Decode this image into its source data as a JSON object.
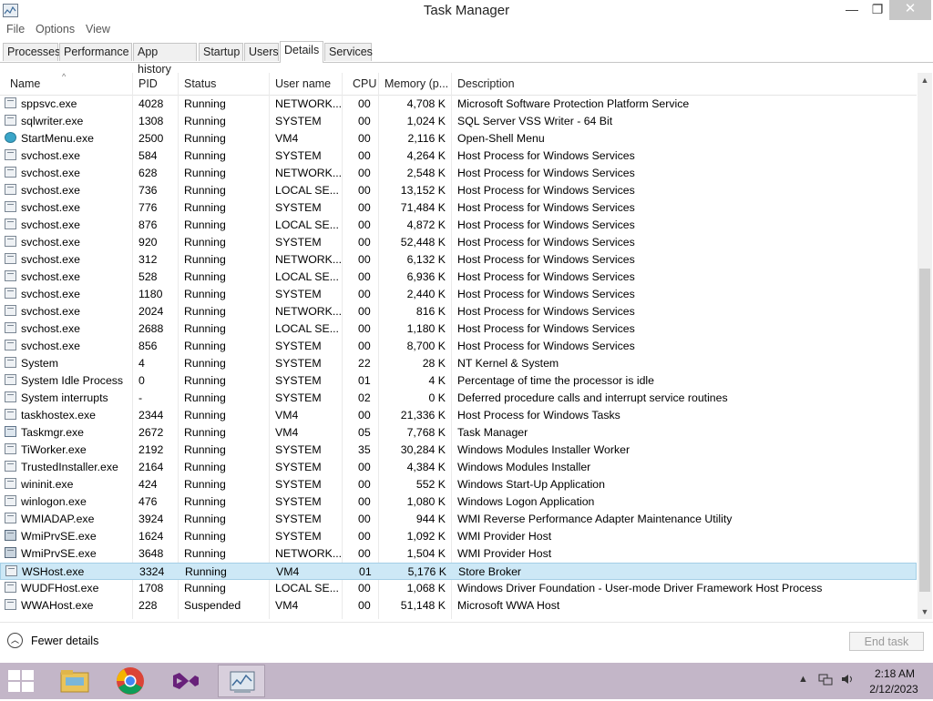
{
  "window": {
    "title": "Task Manager",
    "minimize_glyph": "—",
    "maximize_glyph": "❐",
    "close_glyph": "✕"
  },
  "menu": [
    "File",
    "Options",
    "View"
  ],
  "tabs": [
    {
      "label": "Processes",
      "active": false
    },
    {
      "label": "Performance",
      "active": false
    },
    {
      "label": "App history",
      "active": false
    },
    {
      "label": "Startup",
      "active": false
    },
    {
      "label": "Users",
      "active": false
    },
    {
      "label": "Details",
      "active": true
    },
    {
      "label": "Services",
      "active": false
    }
  ],
  "columns": [
    "Name",
    "PID",
    "Status",
    "User name",
    "CPU",
    "Memory (p...",
    "Description"
  ],
  "rows": [
    {
      "name": "sppsvc.exe",
      "pid": "4028",
      "status": "Running",
      "user": "NETWORK...",
      "cpu": "00",
      "mem": "4,708 K",
      "desc": "Microsoft Software Protection Platform Service",
      "icon": "app"
    },
    {
      "name": "sqlwriter.exe",
      "pid": "1308",
      "status": "Running",
      "user": "SYSTEM",
      "cpu": "00",
      "mem": "1,024 K",
      "desc": "SQL Server VSS Writer - 64 Bit",
      "icon": "app"
    },
    {
      "name": "StartMenu.exe",
      "pid": "2500",
      "status": "Running",
      "user": "VM4",
      "cpu": "00",
      "mem": "2,116 K",
      "desc": "Open-Shell Menu",
      "icon": "shell"
    },
    {
      "name": "svchost.exe",
      "pid": "584",
      "status": "Running",
      "user": "SYSTEM",
      "cpu": "00",
      "mem": "4,264 K",
      "desc": "Host Process for Windows Services",
      "icon": "app"
    },
    {
      "name": "svchost.exe",
      "pid": "628",
      "status": "Running",
      "user": "NETWORK...",
      "cpu": "00",
      "mem": "2,548 K",
      "desc": "Host Process for Windows Services",
      "icon": "app"
    },
    {
      "name": "svchost.exe",
      "pid": "736",
      "status": "Running",
      "user": "LOCAL SE...",
      "cpu": "00",
      "mem": "13,152 K",
      "desc": "Host Process for Windows Services",
      "icon": "app"
    },
    {
      "name": "svchost.exe",
      "pid": "776",
      "status": "Running",
      "user": "SYSTEM",
      "cpu": "00",
      "mem": "71,484 K",
      "desc": "Host Process for Windows Services",
      "icon": "app"
    },
    {
      "name": "svchost.exe",
      "pid": "876",
      "status": "Running",
      "user": "LOCAL SE...",
      "cpu": "00",
      "mem": "4,872 K",
      "desc": "Host Process for Windows Services",
      "icon": "app"
    },
    {
      "name": "svchost.exe",
      "pid": "920",
      "status": "Running",
      "user": "SYSTEM",
      "cpu": "00",
      "mem": "52,448 K",
      "desc": "Host Process for Windows Services",
      "icon": "app"
    },
    {
      "name": "svchost.exe",
      "pid": "312",
      "status": "Running",
      "user": "NETWORK...",
      "cpu": "00",
      "mem": "6,132 K",
      "desc": "Host Process for Windows Services",
      "icon": "app"
    },
    {
      "name": "svchost.exe",
      "pid": "528",
      "status": "Running",
      "user": "LOCAL SE...",
      "cpu": "00",
      "mem": "6,936 K",
      "desc": "Host Process for Windows Services",
      "icon": "app"
    },
    {
      "name": "svchost.exe",
      "pid": "1180",
      "status": "Running",
      "user": "SYSTEM",
      "cpu": "00",
      "mem": "2,440 K",
      "desc": "Host Process for Windows Services",
      "icon": "app"
    },
    {
      "name": "svchost.exe",
      "pid": "2024",
      "status": "Running",
      "user": "NETWORK...",
      "cpu": "00",
      "mem": "816 K",
      "desc": "Host Process for Windows Services",
      "icon": "app"
    },
    {
      "name": "svchost.exe",
      "pid": "2688",
      "status": "Running",
      "user": "LOCAL SE...",
      "cpu": "00",
      "mem": "1,180 K",
      "desc": "Host Process for Windows Services",
      "icon": "app"
    },
    {
      "name": "svchost.exe",
      "pid": "856",
      "status": "Running",
      "user": "SYSTEM",
      "cpu": "00",
      "mem": "8,700 K",
      "desc": "Host Process for Windows Services",
      "icon": "app"
    },
    {
      "name": "System",
      "pid": "4",
      "status": "Running",
      "user": "SYSTEM",
      "cpu": "22",
      "mem": "28 K",
      "desc": "NT Kernel & System",
      "icon": "app"
    },
    {
      "name": "System Idle Process",
      "pid": "0",
      "status": "Running",
      "user": "SYSTEM",
      "cpu": "01",
      "mem": "4 K",
      "desc": "Percentage of time the processor is idle",
      "icon": "app"
    },
    {
      "name": "System interrupts",
      "pid": "-",
      "status": "Running",
      "user": "SYSTEM",
      "cpu": "02",
      "mem": "0 K",
      "desc": "Deferred procedure calls and interrupt service routines",
      "icon": "app"
    },
    {
      "name": "taskhostex.exe",
      "pid": "2344",
      "status": "Running",
      "user": "VM4",
      "cpu": "00",
      "mem": "21,336 K",
      "desc": "Host Process for Windows Tasks",
      "icon": "app"
    },
    {
      "name": "Taskmgr.exe",
      "pid": "2672",
      "status": "Running",
      "user": "VM4",
      "cpu": "05",
      "mem": "7,768 K",
      "desc": "Task Manager",
      "icon": "taskmgr"
    },
    {
      "name": "TiWorker.exe",
      "pid": "2192",
      "status": "Running",
      "user": "SYSTEM",
      "cpu": "35",
      "mem": "30,284 K",
      "desc": "Windows Modules Installer Worker",
      "icon": "app"
    },
    {
      "name": "TrustedInstaller.exe",
      "pid": "2164",
      "status": "Running",
      "user": "SYSTEM",
      "cpu": "00",
      "mem": "4,384 K",
      "desc": "Windows Modules Installer",
      "icon": "app"
    },
    {
      "name": "wininit.exe",
      "pid": "424",
      "status": "Running",
      "user": "SYSTEM",
      "cpu": "00",
      "mem": "552 K",
      "desc": "Windows Start-Up Application",
      "icon": "app"
    },
    {
      "name": "winlogon.exe",
      "pid": "476",
      "status": "Running",
      "user": "SYSTEM",
      "cpu": "00",
      "mem": "1,080 K",
      "desc": "Windows Logon Application",
      "icon": "app"
    },
    {
      "name": "WMIADAP.exe",
      "pid": "3924",
      "status": "Running",
      "user": "SYSTEM",
      "cpu": "00",
      "mem": "944 K",
      "desc": "WMI Reverse Performance Adapter Maintenance Utility",
      "icon": "app"
    },
    {
      "name": "WmiPrvSE.exe",
      "pid": "1624",
      "status": "Running",
      "user": "SYSTEM",
      "cpu": "00",
      "mem": "1,092 K",
      "desc": "WMI Provider Host",
      "icon": "wmi"
    },
    {
      "name": "WmiPrvSE.exe",
      "pid": "3648",
      "status": "Running",
      "user": "NETWORK...",
      "cpu": "00",
      "mem": "1,504 K",
      "desc": "WMI Provider Host",
      "icon": "wmi"
    },
    {
      "name": "WSHost.exe",
      "pid": "3324",
      "status": "Running",
      "user": "VM4",
      "cpu": "01",
      "mem": "5,176 K",
      "desc": "Store Broker",
      "icon": "app",
      "selected": true
    },
    {
      "name": "WUDFHost.exe",
      "pid": "1708",
      "status": "Running",
      "user": "LOCAL SE...",
      "cpu": "00",
      "mem": "1,068 K",
      "desc": "Windows Driver Foundation - User-mode Driver Framework Host Process",
      "icon": "app"
    },
    {
      "name": "WWAHost.exe",
      "pid": "228",
      "status": "Suspended",
      "user": "VM4",
      "cpu": "00",
      "mem": "51,148 K",
      "desc": "Microsoft WWA Host",
      "icon": "app"
    }
  ],
  "footer": {
    "fewer_details": "Fewer details",
    "end_task": "End task"
  },
  "taskbar": {
    "apps": [
      "file-explorer-icon",
      "chrome-icon",
      "visual-studio-icon",
      "task-manager-icon"
    ],
    "time": "2:18 AM",
    "date": "2/12/2023"
  },
  "colors": {
    "selection": "#cde8f6",
    "taskbar": "#c3b6c8",
    "close_button": "#c7c7c7"
  }
}
